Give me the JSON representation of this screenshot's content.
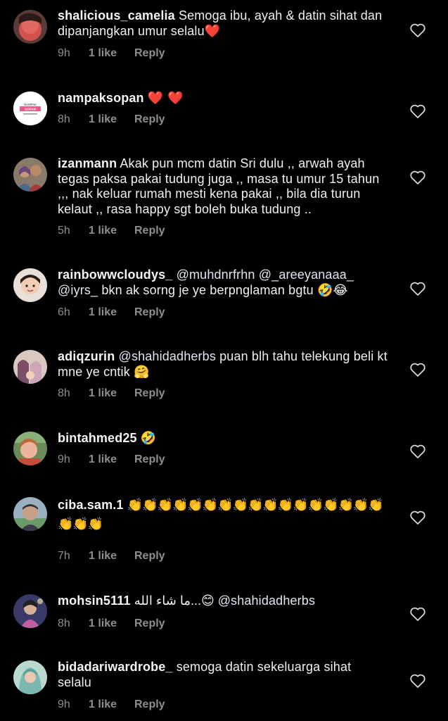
{
  "comments": [
    {
      "username": "shalicious_camelia",
      "text": "Semoga ibu, ayah & datin sihat dan dipanjangkan umur selalu",
      "emoji": "❤️",
      "time": "9h",
      "likes": "1 like",
      "reply": "Reply",
      "avatar": "pink-face-avatar"
    },
    {
      "username": "nampaksopan",
      "text": "",
      "emoji": "❤️ ❤️",
      "time": "8h",
      "likes": "1 like",
      "reply": "Reply",
      "avatar": "nampak-sopan-logo",
      "avatar_text_top": "NAMPAK",
      "avatar_text_mid": "SOPAN"
    },
    {
      "username": "izanmann",
      "text": "Akak pun mcm datin Sri dulu ,, arwah ayah tegas paksa pakai tudung juga ,, masa tu umur 15 tahun ,,, nak keluar rumah mesti kena pakai ,, bila dia turun kelaut ,, rasa happy sgt boleh buka tudung ..",
      "time": "5h",
      "likes": "1 like",
      "reply": "Reply",
      "avatar": "couple-photo-avatar"
    },
    {
      "username": "rainbowwcloudys_",
      "mention1": "@muhdnrfrhn",
      "mention2": "@_areeyanaaa_",
      "mention3": "@iyrs_",
      "text": "bkn ak sorng je ye berpnglaman bgtu",
      "emoji": "🤣😂",
      "time": "6h",
      "likes": "1 like",
      "reply": "Reply",
      "avatar": "child-photo-avatar"
    },
    {
      "username": "adiqzurin",
      "mention1": "@shahidadherbs",
      "text": "puan blh tahu telekung beli kt mne ye cntik",
      "emoji": "🤗",
      "time": "8h",
      "likes": "1 like",
      "reply": "Reply",
      "avatar": "family-photo-avatar"
    },
    {
      "username": "bintahmed25",
      "emoji": "🤣",
      "time": "9h",
      "likes": "1 like",
      "reply": "Reply",
      "avatar": "boy-photo-avatar"
    },
    {
      "username": "ciba.sam.1",
      "emoji": "👏👏👏👏👏👏👏👏👏👏👏👏👏👏👏👏👏👏👏👏",
      "time": "7h",
      "likes": "1 like",
      "reply": "Reply",
      "avatar": "man-photo-avatar"
    },
    {
      "username": "mohsin5111",
      "text": "ما شاء الله...",
      "emoji": "😊",
      "mention1": "@shahidadherbs",
      "time": "8h",
      "likes": "1 like",
      "reply": "Reply",
      "avatar": "performer-photo-avatar"
    },
    {
      "username": "bidadariwardrobe_",
      "text": "semoga datin sekeluarga sihat selalu",
      "time": "9h",
      "likes": "1 like",
      "reply": "Reply",
      "avatar": "hijab-woman-avatar"
    }
  ],
  "colors": {
    "background": "#000000",
    "meta_text": "#8e8e8e",
    "heart_outline": "#d8d8d8"
  },
  "icons": {
    "like": "heart-outline-icon"
  }
}
